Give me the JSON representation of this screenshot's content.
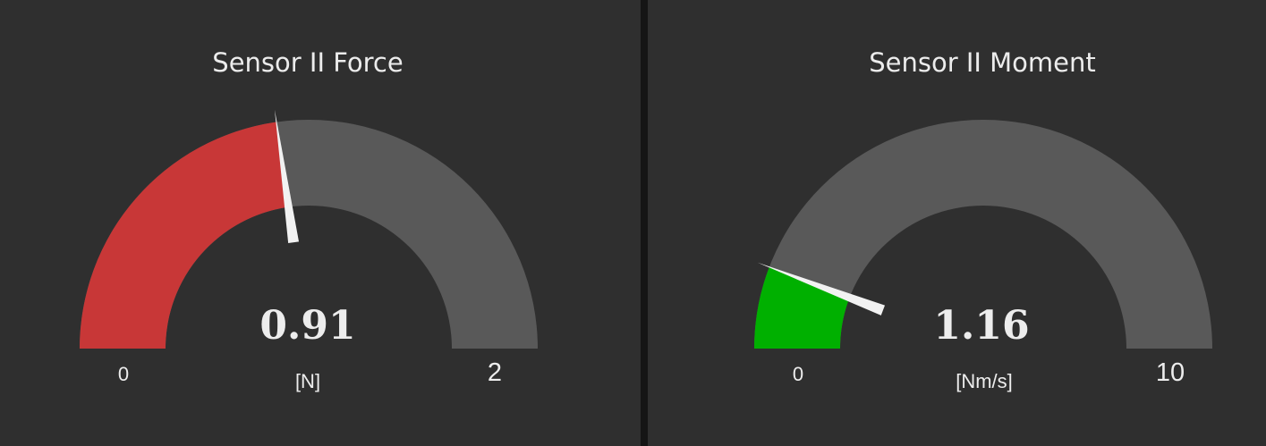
{
  "gauges": [
    {
      "title": "Sensor II Force",
      "value_text": "0.91",
      "value": 0.91,
      "min": 0,
      "max": 2,
      "min_label": "0",
      "max_label": "2",
      "unit": "[N]",
      "fill_color": "#c83737",
      "track_color": "#595959"
    },
    {
      "title": "Sensor II Moment",
      "value_text": "1.16",
      "value": 1.16,
      "min": 0,
      "max": 10,
      "min_label": "0",
      "max_label": "10",
      "unit": "[Nm/s]",
      "fill_color": "#00b000",
      "track_color": "#595959"
    }
  ],
  "colors": {
    "background": "#2f2f2f",
    "divider": "#151515",
    "text": "#ececec",
    "needle": "#f2f2f2"
  }
}
